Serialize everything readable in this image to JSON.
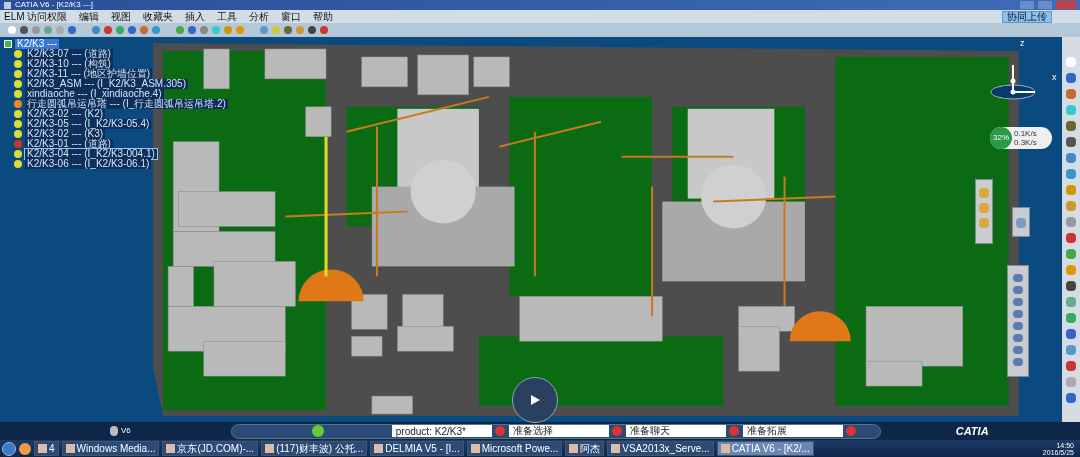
{
  "window": {
    "title": "CATIA V6 - [K2/K3 ---]"
  },
  "menu": {
    "app_label": "ELM 访问权限",
    "items": [
      "编辑",
      "视图",
      "收藏夹",
      "插入",
      "工具",
      "分析",
      "窗口",
      "帮助"
    ],
    "upload_button": "协同上传"
  },
  "tree": {
    "label": "K2/K3 ---",
    "kind": "root",
    "selected": true,
    "outlined": false,
    "children": [
      {
        "label": "K2/K3-07 --- (道路)",
        "kind": "product",
        "selected": false,
        "outlined": false
      },
      {
        "label": "K2/K3-10 --- (构筑)",
        "kind": "product",
        "selected": false,
        "outlined": false
      },
      {
        "label": "K2/K3-11 --- (地区护墙位置)",
        "kind": "product",
        "selected": false,
        "outlined": false
      },
      {
        "label": "K2/K3_ASM --- (I_K2/K3_ASM.305)",
        "kind": "product",
        "selected": false,
        "outlined": false
      },
      {
        "label": "xindiaoche --- (I_xindiaoche.4)",
        "kind": "product",
        "selected": false,
        "outlined": false
      },
      {
        "label": "行走圆弧吊运吊塔 --- (I_行走圆弧吊运吊塔.2)",
        "kind": "crane",
        "selected": false,
        "outlined": false
      },
      {
        "label": "K2/K3-02 --- (K2)",
        "kind": "product",
        "selected": false,
        "outlined": false
      },
      {
        "label": "K2/K3-05 --- (I_K2/K3-05.4)",
        "kind": "product",
        "selected": false,
        "outlined": false
      },
      {
        "label": "K2/K3-02 --- (K3)",
        "kind": "product",
        "selected": false,
        "outlined": false
      },
      {
        "label": "K2/K3-01 --- (道路)",
        "kind": "part",
        "selected": false,
        "outlined": false
      },
      {
        "label": "K2/K3-04 --- (I_K2/K3-004.1)",
        "kind": "product",
        "selected": false,
        "outlined": true
      },
      {
        "label": "K2/K3-06 --- (I_K2/K3-06.1)",
        "kind": "product",
        "selected": false,
        "outlined": false
      }
    ]
  },
  "compass": {
    "z_label": "z",
    "x_label": "x"
  },
  "network_meter": {
    "percent": "32%",
    "upload": "0.1K/s",
    "download": "0.3K/s"
  },
  "status_bar": {
    "version": "V6",
    "fields": [
      {
        "value": "product: K2/K3*"
      },
      {
        "value": "准备选择"
      },
      {
        "value": "准备聊天"
      },
      {
        "value": "准备拓展"
      }
    ],
    "logo": "CATIA"
  },
  "taskbar": {
    "apps": [
      {
        "label": "4",
        "selected": false
      },
      {
        "label": "Windows Media...",
        "selected": false
      },
      {
        "label": "京东(JD.COM)-...",
        "selected": false
      },
      {
        "label": "(117)财丰波) 公托...",
        "selected": false
      },
      {
        "label": "DELMIA V5 - [I...",
        "selected": false
      },
      {
        "label": "Microsoft Powe...",
        "selected": false
      },
      {
        "label": "阿杰",
        "selected": false
      },
      {
        "label": "VSA2013x_Serve...",
        "selected": false
      },
      {
        "label": "CATIA V6 - [K2/...",
        "selected": true
      }
    ],
    "time": "14:50",
    "date": "2016/5/25"
  }
}
